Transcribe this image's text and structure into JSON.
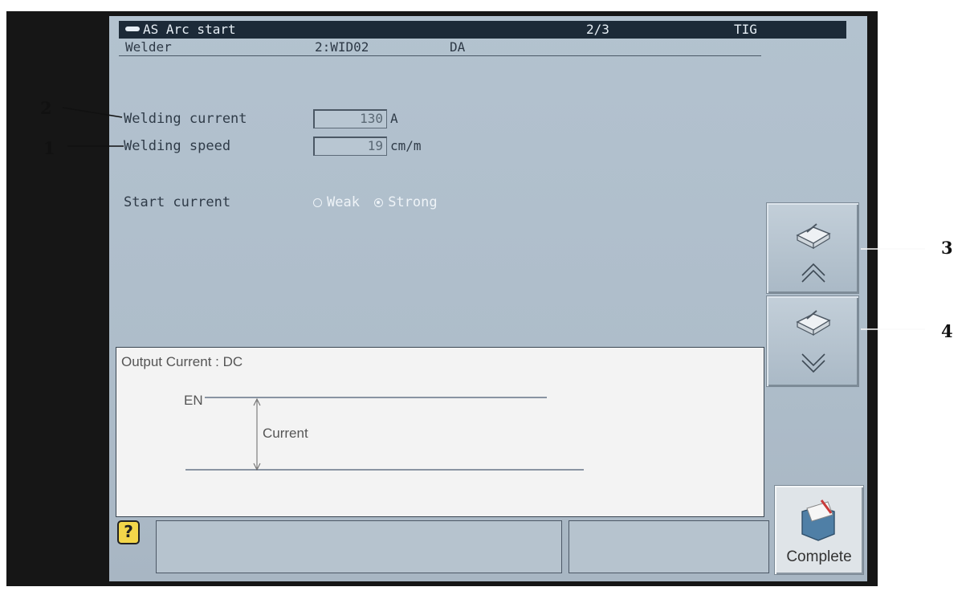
{
  "header": {
    "title": "AS Arc start",
    "page": "2/3",
    "mode": "TIG"
  },
  "welder": {
    "label": "Welder",
    "id": "2:WID02",
    "type": "DA"
  },
  "fields": {
    "welding_current": {
      "label": "Welding current",
      "value": "130",
      "unit": "A"
    },
    "welding_speed": {
      "label": "Welding speed",
      "value": "19",
      "unit": "cm/m"
    }
  },
  "start_current": {
    "label": "Start current",
    "options": [
      "Weak",
      "Strong"
    ],
    "selected": "Strong"
  },
  "info_panel": {
    "title": "Output Current : DC",
    "en_label": "EN",
    "current_label": "Current"
  },
  "buttons": {
    "complete_label": "Complete"
  },
  "help_icon": "?",
  "callouts": [
    "1",
    "2",
    "3",
    "4"
  ]
}
